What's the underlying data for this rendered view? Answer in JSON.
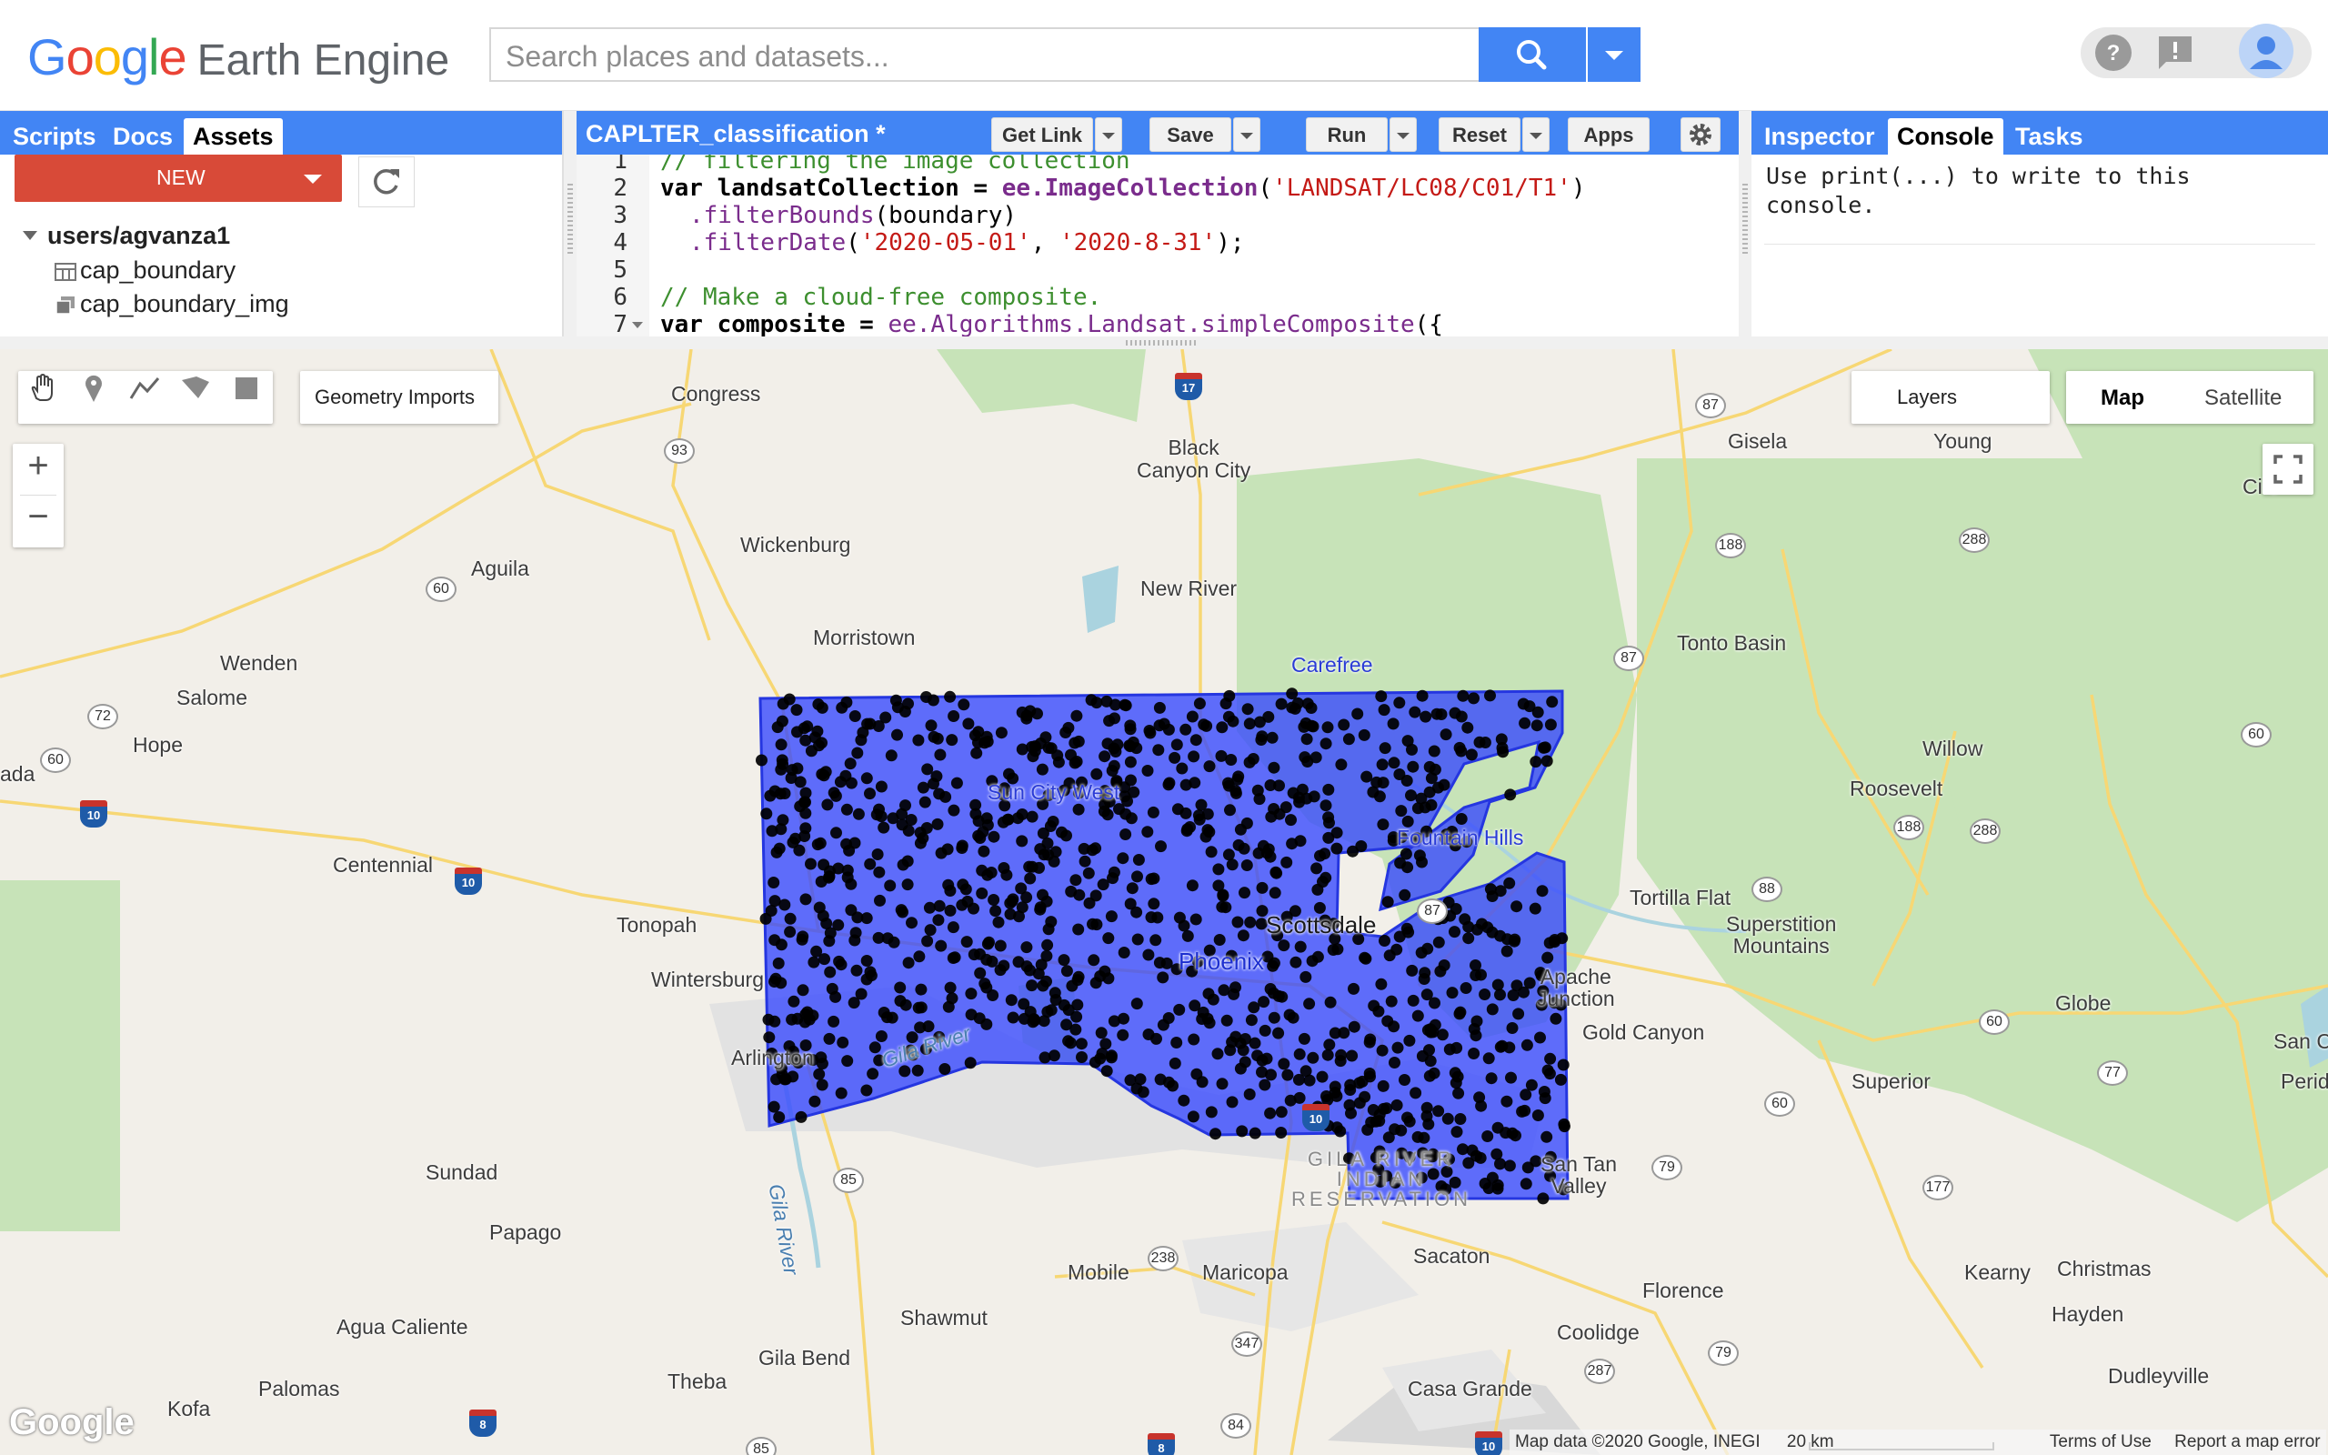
{
  "header": {
    "logo_google": "Google",
    "logo_product": "Earth Engine",
    "search_placeholder": "Search places and datasets...",
    "icons": [
      "help-icon",
      "feedback-icon",
      "account-avatar"
    ]
  },
  "left_panel": {
    "tabs": [
      "Scripts",
      "Docs",
      "Assets"
    ],
    "active_tab": "Assets",
    "new_label": "NEW",
    "tree": {
      "root": "users/agvanza1",
      "items": [
        {
          "label": "cap_boundary",
          "icon": "table-icon"
        },
        {
          "label": "cap_boundary_img",
          "icon": "image-collection-icon"
        }
      ]
    }
  },
  "code_editor": {
    "title": "CAPLTER_classification *",
    "buttons": {
      "get_link": "Get Link",
      "save": "Save",
      "run": "Run",
      "reset": "Reset",
      "apps": "Apps"
    },
    "line_numbers": [
      "1",
      "2",
      "3",
      "4",
      "5",
      "6",
      "7"
    ],
    "lines": {
      "l1": "// filtering the image collection",
      "l2_var": "var landsatCollection = ",
      "l2_fn": "ee.ImageCollection",
      "l2_open": "(",
      "l2_str": "'LANDSAT/LC08/C01/T1'",
      "l2_close": ")",
      "l3_fn": ".filterBounds",
      "l3_arg": "(boundary)",
      "l4_fn": ".filterDate",
      "l4_open": "(",
      "l4_s1": "'2020-05-01'",
      "l4_comma": ", ",
      "l4_s2": "'2020-8-31'",
      "l4_close": ");",
      "l6": "// Make a cloud-free composite.",
      "l7_var": "var composite = ",
      "l7_fn": "ee.Algorithms.Landsat.simpleComposite",
      "l7_rest": "({"
    }
  },
  "right_panel": {
    "tabs": [
      "Inspector",
      "Console",
      "Tasks"
    ],
    "active_tab": "Console",
    "console_message": "Use print(...) to write to this console."
  },
  "map": {
    "geometry_imports": "Geometry Imports",
    "layers": "Layers",
    "map_type": [
      "Map",
      "Satellite"
    ],
    "active_map_type": "Map",
    "zoom_in": "+",
    "zoom_out": "−",
    "polygon_color": "#3446ff",
    "sample_point_color": "#000000",
    "places": {
      "congress": "Congress",
      "black_canyon_city": "Black\nCanyon City",
      "gisela": "Gisela",
      "young": "Young",
      "wickenburg": "Wickenburg",
      "aguila": "Aguila",
      "new_river": "New River",
      "morristown": "Morristown",
      "carefree": "Carefree",
      "tonto_basin": "Tonto Basin",
      "wenden": "Wenden",
      "salome": "Salome",
      "hope": "Hope",
      "willow": "Willow",
      "roosevelt": "Roosevelt",
      "centennial": "Centennial",
      "fountain_hills": "Fountain Hills",
      "tortilla_flat": "Tortilla Flat",
      "superstition": "Superstition\nMountains",
      "tonopah": "Tonopah",
      "scottsdale": "Scottsdale",
      "phoenix": "Phoenix",
      "wintersburg": "Wintersburg",
      "apache_junction": "Apache\nJunction",
      "globe": "Globe",
      "gold_canyon": "Gold Canyon",
      "arlington": "Arlington",
      "superior": "Superior",
      "san_carlos": "San Car",
      "peridot": "Perido",
      "gila_river_res": "GILA RIVER\nINDIAN\nRESERVATION",
      "san_tan_valley": "San Tan\nValley",
      "sundad": "Sundad",
      "papago": "Papago",
      "mobile": "Mobile",
      "maricopa": "Maricopa",
      "sacaton": "Sacaton",
      "florence": "Florence",
      "kearny": "Kearny",
      "christmas": "Christmas",
      "hayden": "Hayden",
      "agua_caliente": "Agua Caliente",
      "shawmut": "Shawmut",
      "coolidge": "Coolidge",
      "gila_bend": "Gila Bend",
      "theba": "Theba",
      "palomas": "Palomas",
      "casa_grande": "Casa Grande",
      "dudleyville": "Dudleyville",
      "kofa": "Kofa",
      "ada": "ada",
      "sun_city_west": "Sun City West",
      "gila_river": "Gila River",
      "gila_river2": "Gila River",
      "cie": "Ci e"
    },
    "attribution": {
      "map_data": "Map data ©2020 Google, INEGI",
      "scale": "20 km",
      "terms": "Terms of Use",
      "report": "Report a map error"
    },
    "watermark": "Google"
  }
}
